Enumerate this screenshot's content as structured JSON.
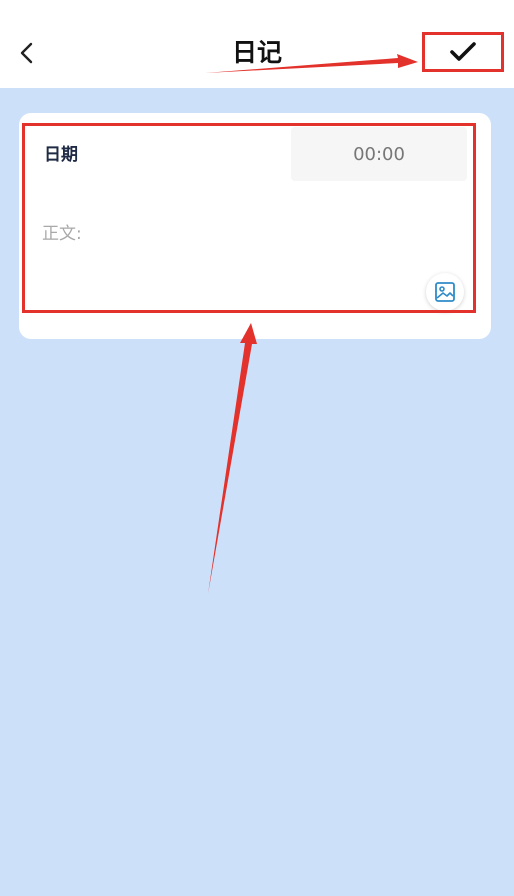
{
  "header": {
    "title": "日记",
    "back_icon": "chevron-left-icon",
    "confirm_icon": "checkmark-icon"
  },
  "form": {
    "date_label": "日期",
    "time_value": "00:00",
    "body_placeholder": "正文:",
    "image_icon": "image-icon"
  },
  "colors": {
    "page_background": "#cde0fa",
    "highlight": "#e3312b",
    "image_icon_color": "#2f8bc8"
  }
}
